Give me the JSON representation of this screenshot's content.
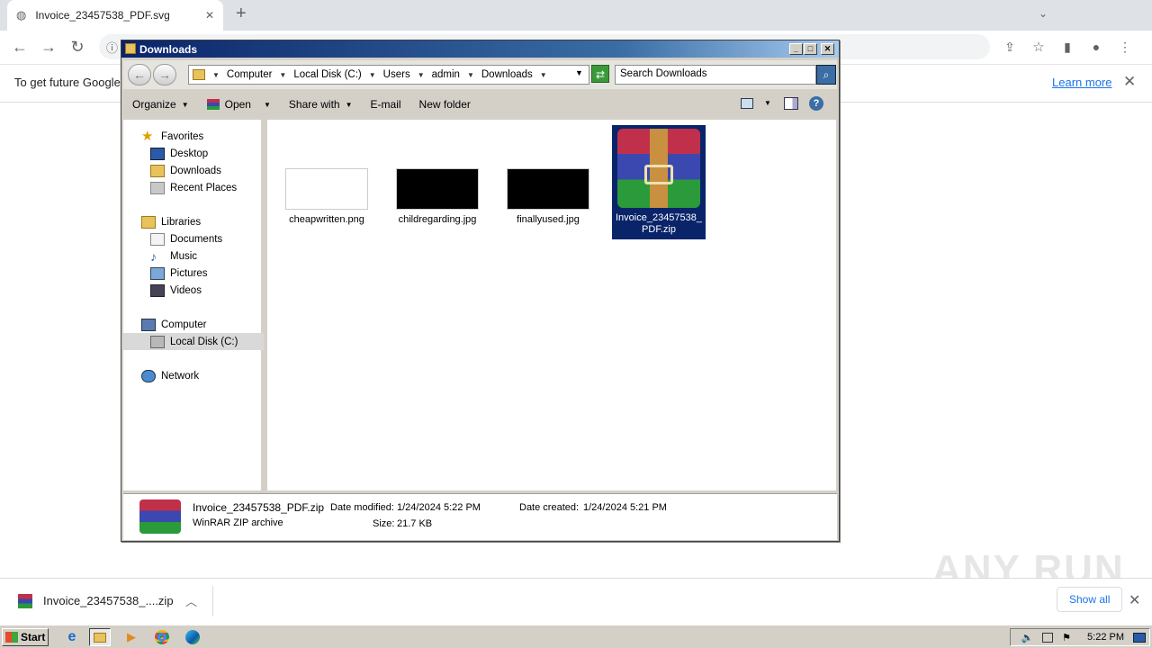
{
  "browser": {
    "tab_title": "Invoice_23457538_PDF.svg",
    "new_tab": "+",
    "info_msg": "To get future Google",
    "learn_more": "Learn more",
    "close": "✕"
  },
  "explorer": {
    "title": "Downloads",
    "breadcrumb": [
      "Computer",
      "Local Disk (C:)",
      "Users",
      "admin",
      "Downloads"
    ],
    "search_placeholder": "Search Downloads",
    "commands": [
      "Organize",
      "Open",
      "Share with",
      "E-mail",
      "New folder"
    ],
    "nav": {
      "favorites": "Favorites",
      "desktop": "Desktop",
      "downloads": "Downloads",
      "recent": "Recent Places",
      "libraries": "Libraries",
      "documents": "Documents",
      "music": "Music",
      "pictures": "Pictures",
      "videos": "Videos",
      "computer": "Computer",
      "localdisk": "Local Disk (C:)",
      "network": "Network"
    },
    "files": [
      {
        "name": "cheapwritten.png"
      },
      {
        "name": "childregarding.jpg"
      },
      {
        "name": "finallyused.jpg"
      },
      {
        "name": "Invoice_23457538_PDF.zip"
      }
    ],
    "status": {
      "name": "Invoice_23457538_PDF.zip",
      "type": "WinRAR ZIP archive",
      "modified_label": "Date modified:",
      "modified": "1/24/2024 5:22 PM",
      "created_label": "Date created:",
      "created": "1/24/2024 5:21 PM",
      "size_label": "Size:",
      "size": "21.7 KB"
    }
  },
  "download_bar": {
    "file": "Invoice_23457538_....zip",
    "show_all": "Show all"
  },
  "taskbar": {
    "start": "Start",
    "clock": "5:22 PM"
  },
  "watermark": "ANY RUN"
}
